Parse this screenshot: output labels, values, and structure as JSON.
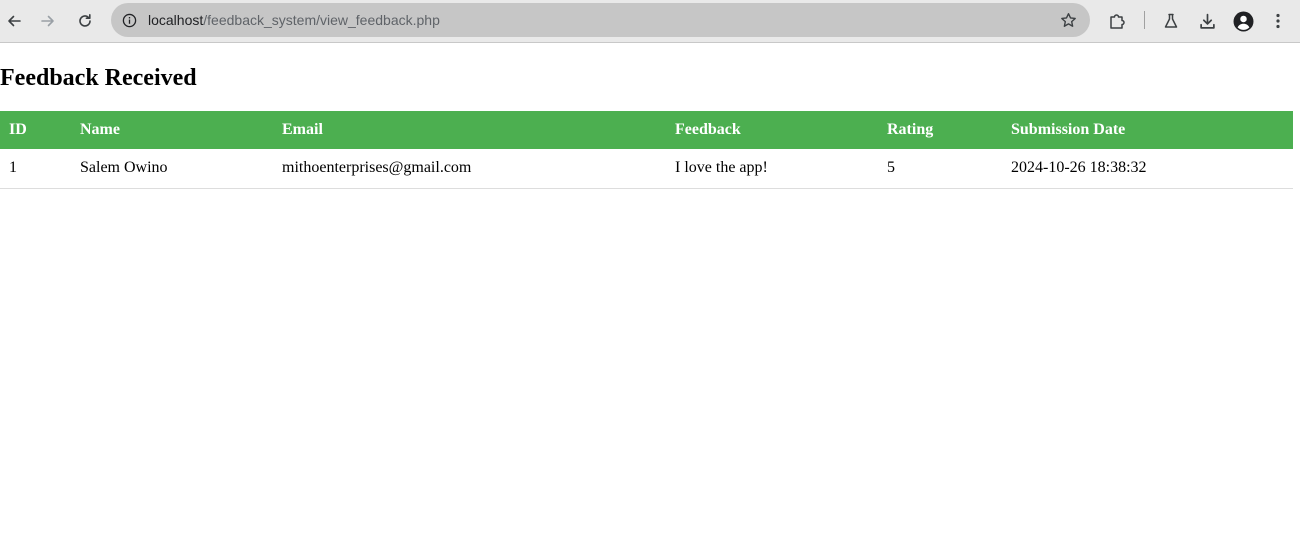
{
  "browser": {
    "url_host": "localhost",
    "url_path": "/feedback_system/view_feedback.php",
    "icons": {
      "back": "back-arrow-icon",
      "forward": "forward-arrow-icon",
      "reload": "reload-icon",
      "site_info": "info-icon",
      "bookmark": "star-icon",
      "extensions": "puzzle-icon",
      "labs": "flask-icon",
      "downloads": "download-icon",
      "profile": "profile-avatar-icon",
      "menu": "kebab-menu-icon"
    }
  },
  "page": {
    "title": "Feedback Received"
  },
  "table": {
    "header_color": "#4caf50",
    "columns": [
      "ID",
      "Name",
      "Email",
      "Feedback",
      "Rating",
      "Submission Date"
    ],
    "rows": [
      {
        "id": "1",
        "name": "Salem Owino",
        "email": "mithoenterprises@gmail.com",
        "feedback": "I love the app!",
        "rating": "5",
        "submission_date": "2024-10-26 18:38:32"
      }
    ]
  }
}
